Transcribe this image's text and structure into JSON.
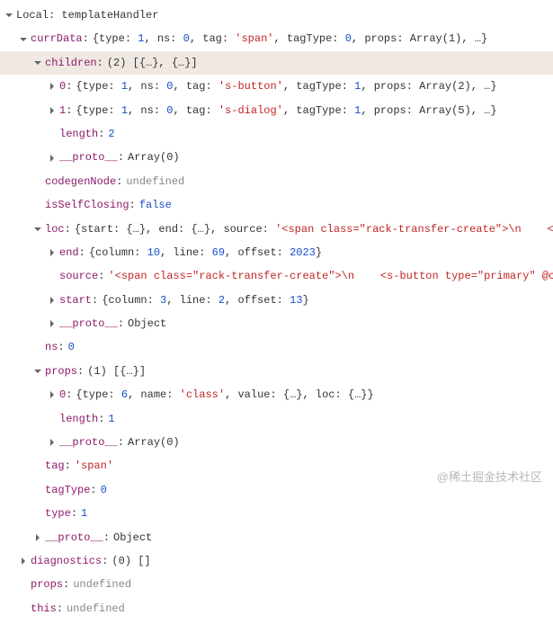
{
  "header": {
    "scope": "Local:",
    "name": "templateHandler"
  },
  "tree": [
    {
      "indent": 1,
      "arrow": "down",
      "key": "currData",
      "value_html": "{type: <n>1</n>, ns: <n>0</n>, tag: <s>'span'</s>, tagType: <n>0</n>, props: Array(1), …}"
    },
    {
      "indent": 2,
      "arrow": "down",
      "key": "children",
      "value_html": "(2) [{…}, {…}]",
      "selected": true
    },
    {
      "indent": 3,
      "arrow": "right",
      "key": "0",
      "value_html": "{type: <n>1</n>, ns: <n>0</n>, tag: <s>'s-button'</s>, tagType: <n>1</n>, props: Array(2), …}"
    },
    {
      "indent": 3,
      "arrow": "right",
      "key": "1",
      "value_html": "{type: <n>1</n>, ns: <n>0</n>, tag: <s>'s-dialog'</s>, tagType: <n>1</n>, props: Array(5), …}"
    },
    {
      "indent": 3,
      "arrow": "none",
      "key": "length",
      "value_html": "<n>2</n>"
    },
    {
      "indent": 3,
      "arrow": "right",
      "key": "__proto__",
      "value_html": "Array(0)"
    },
    {
      "indent": 2,
      "arrow": "none",
      "key": "codegenNode",
      "value_html": "<u>undefined</u>"
    },
    {
      "indent": 2,
      "arrow": "none",
      "key": "isSelfClosing",
      "value_html": "<b>false</b>"
    },
    {
      "indent": 2,
      "arrow": "down",
      "key": "loc",
      "value_html": "{start: {…}, end: {…}, source: <s>'&lt;span class=\"rack-transfer-create\"&gt;\\n&nbsp;&nbsp;&nbsp;&nbsp;&lt;s-bu…</s>"
    },
    {
      "indent": 3,
      "arrow": "right",
      "key": "end",
      "value_html": "{column: <n>10</n>, line: <n>69</n>, offset: <n>2023</n>}"
    },
    {
      "indent": 3,
      "arrow": "none",
      "key": "source",
      "value_html": "<s>'&lt;span class=\"rack-transfer-create\"&gt;\\n&nbsp;&nbsp;&nbsp;&nbsp;&lt;s-button type=\"primary\" @click=\"…</s>"
    },
    {
      "indent": 3,
      "arrow": "right",
      "key": "start",
      "value_html": "{column: <n>3</n>, line: <n>2</n>, offset: <n>13</n>}"
    },
    {
      "indent": 3,
      "arrow": "right",
      "key": "__proto__",
      "value_html": "Object"
    },
    {
      "indent": 2,
      "arrow": "none",
      "key": "ns",
      "value_html": "<n>0</n>"
    },
    {
      "indent": 2,
      "arrow": "down",
      "key": "props",
      "value_html": "(1) [{…}]"
    },
    {
      "indent": 3,
      "arrow": "right",
      "key": "0",
      "value_html": "{type: <n>6</n>, name: <s>'class'</s>, value: {…}, loc: {…}}"
    },
    {
      "indent": 3,
      "arrow": "none",
      "key": "length",
      "value_html": "<n>1</n>"
    },
    {
      "indent": 3,
      "arrow": "right",
      "key": "__proto__",
      "value_html": "Array(0)"
    },
    {
      "indent": 2,
      "arrow": "none",
      "key": "tag",
      "value_html": "<s>'span'</s>"
    },
    {
      "indent": 2,
      "arrow": "none",
      "key": "tagType",
      "value_html": "<n>0</n>"
    },
    {
      "indent": 2,
      "arrow": "none",
      "key": "type",
      "value_html": "<n>1</n>"
    },
    {
      "indent": 2,
      "arrow": "right",
      "key": "__proto__",
      "value_html": "Object"
    },
    {
      "indent": 1,
      "arrow": "right",
      "key": "diagnostics",
      "value_html": "(0) []"
    },
    {
      "indent": 1,
      "arrow": "none",
      "key": "props",
      "value_html": "<u>undefined</u>"
    },
    {
      "indent": 1,
      "arrow": "none",
      "key": "this",
      "value_html": "<u>undefined</u>"
    }
  ],
  "watermark": "@稀土掘金技术社区"
}
